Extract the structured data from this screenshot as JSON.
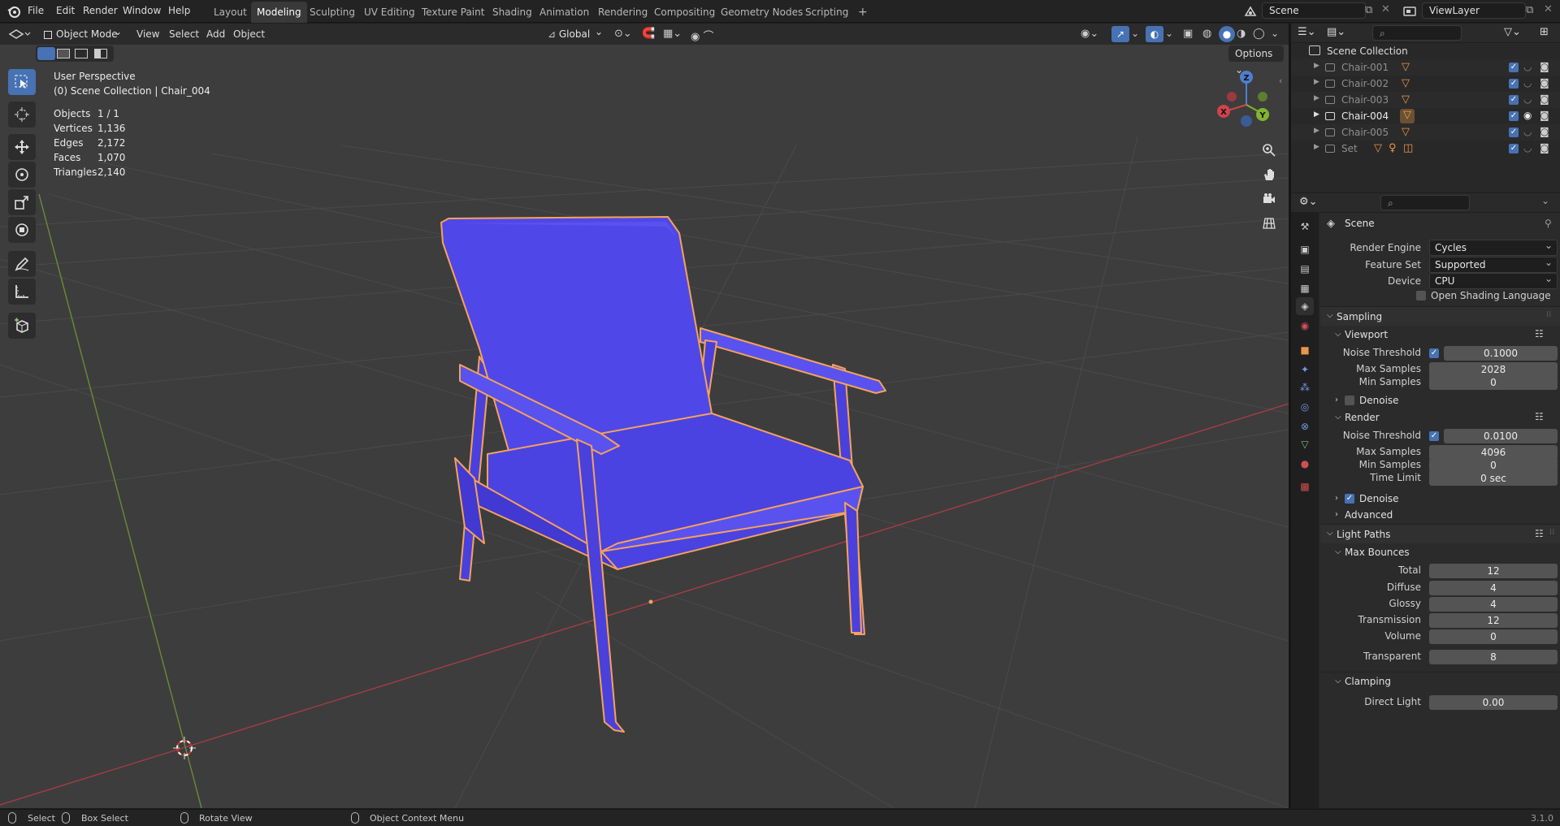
{
  "topbar": {
    "menus": [
      "File",
      "Edit",
      "Render",
      "Window",
      "Help"
    ],
    "workspaces": [
      "Layout",
      "Modeling",
      "Sculpting",
      "UV Editing",
      "Texture Paint",
      "Shading",
      "Animation",
      "Rendering",
      "Compositing",
      "Geometry Nodes",
      "Scripting"
    ],
    "active_workspace": "Modeling",
    "add_tab": "+",
    "scene": "Scene",
    "view_layer": "ViewLayer"
  },
  "viewport_header": {
    "mode": "Object Mode",
    "menus": [
      "View",
      "Select",
      "Add",
      "Object"
    ],
    "orientation": "Global",
    "options": "Options"
  },
  "viewport": {
    "perspective": "User Perspective",
    "collection_path": "(0) Scene Collection | Chair_004",
    "stats": [
      {
        "label": "Objects",
        "value": "1 / 1"
      },
      {
        "label": "Vertices",
        "value": "1,136"
      },
      {
        "label": "Edges",
        "value": "2,172"
      },
      {
        "label": "Faces",
        "value": "1,070"
      },
      {
        "label": "Triangles",
        "value": "2,140"
      }
    ],
    "gizmo": {
      "x": "X",
      "y": "Y",
      "z": "Z"
    },
    "tools": [
      "select-box-tool",
      "cursor-tool",
      "move-tool",
      "rotate-tool",
      "scale-tool",
      "transform-tool",
      "annotate-tool",
      "measure-tool",
      "add-cube-tool"
    ],
    "chair_color": "#5047e8",
    "outline_color": "#f5a25a"
  },
  "outliner": {
    "root": "Scene Collection",
    "items": [
      {
        "name": "Chair-001",
        "active": false
      },
      {
        "name": "Chair-002",
        "active": false
      },
      {
        "name": "Chair-003",
        "active": false
      },
      {
        "name": "Chair-004",
        "active": true
      },
      {
        "name": "Chair-005",
        "active": false
      },
      {
        "name": "Set",
        "active": false
      }
    ]
  },
  "properties": {
    "context": "Scene",
    "render_engine": {
      "label": "Render Engine",
      "value": "Cycles"
    },
    "feature_set": {
      "label": "Feature Set",
      "value": "Supported"
    },
    "device": {
      "label": "Device",
      "value": "CPU"
    },
    "osl": "Open Shading Language",
    "sampling": {
      "title": "Sampling",
      "viewport": {
        "title": "Viewport",
        "noise_threshold": {
          "label": "Noise Threshold",
          "value": "0.1000"
        },
        "max_samples": {
          "label": "Max Samples",
          "value": "2028"
        },
        "min_samples": {
          "label": "Min Samples",
          "value": "0"
        },
        "denoise": "Denoise"
      },
      "render": {
        "title": "Render",
        "noise_threshold": {
          "label": "Noise Threshold",
          "value": "0.0100"
        },
        "max_samples": {
          "label": "Max Samples",
          "value": "4096"
        },
        "min_samples": {
          "label": "Min Samples",
          "value": "0"
        },
        "time_limit": {
          "label": "Time Limit",
          "value": "0 sec"
        },
        "denoise": "Denoise"
      },
      "advanced": "Advanced"
    },
    "light_paths": {
      "title": "Light Paths",
      "max_bounces": {
        "title": "Max Bounces",
        "total": {
          "label": "Total",
          "value": "12"
        },
        "diffuse": {
          "label": "Diffuse",
          "value": "4"
        },
        "glossy": {
          "label": "Glossy",
          "value": "4"
        },
        "transmission": {
          "label": "Transmission",
          "value": "12"
        },
        "volume": {
          "label": "Volume",
          "value": "0"
        },
        "transparent": {
          "label": "Transparent",
          "value": "8"
        }
      },
      "clamping": {
        "title": "Clamping",
        "direct_light": {
          "label": "Direct Light",
          "value": "0.00"
        }
      }
    }
  },
  "statusbar": {
    "select": "Select",
    "box_select": "Box Select",
    "rotate_view": "Rotate View",
    "context_menu": "Object Context Menu",
    "version": "3.1.0"
  }
}
